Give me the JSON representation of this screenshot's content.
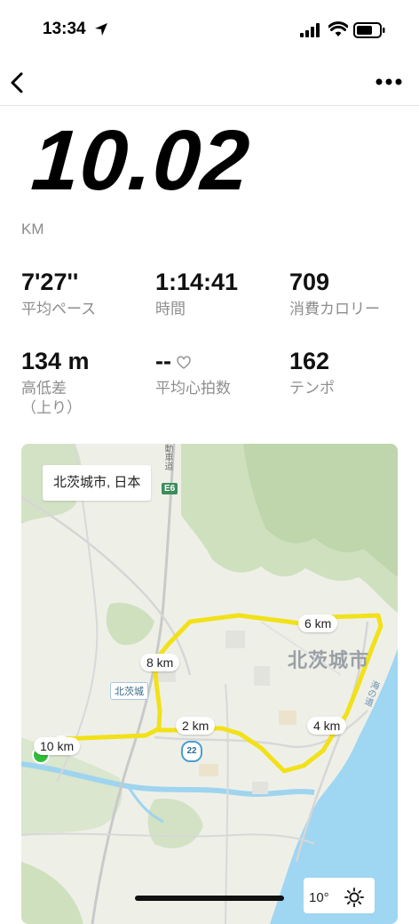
{
  "status": {
    "time": "13:34"
  },
  "summary": {
    "distance": "10.02",
    "unit": "KM"
  },
  "stats": [
    {
      "value": "7'27''",
      "label": "平均ペース"
    },
    {
      "value": "1:14:41",
      "label": "時間"
    },
    {
      "value": "709",
      "label": "消費カロリー"
    },
    {
      "value": "134 m",
      "label": "高低差\n（上り）"
    },
    {
      "value": "--",
      "label": "平均心拍数"
    },
    {
      "value": "162",
      "label": "テンポ"
    }
  ],
  "map": {
    "location": "北茨城市, 日本",
    "city": "北茨城市",
    "road_shield": "E6",
    "station": "北茨城",
    "route_badge": "22",
    "road_vertical": "動車道",
    "road_coast": "海の道",
    "km_labels": [
      "2 km",
      "4 km",
      "6 km",
      "8 km",
      "10 km"
    ],
    "route_color": "#f2e118",
    "start_color": "#2fbf3a",
    "end_color": "#e0141b",
    "weather": {
      "temp": "10°",
      "icon": "sun-icon"
    }
  }
}
